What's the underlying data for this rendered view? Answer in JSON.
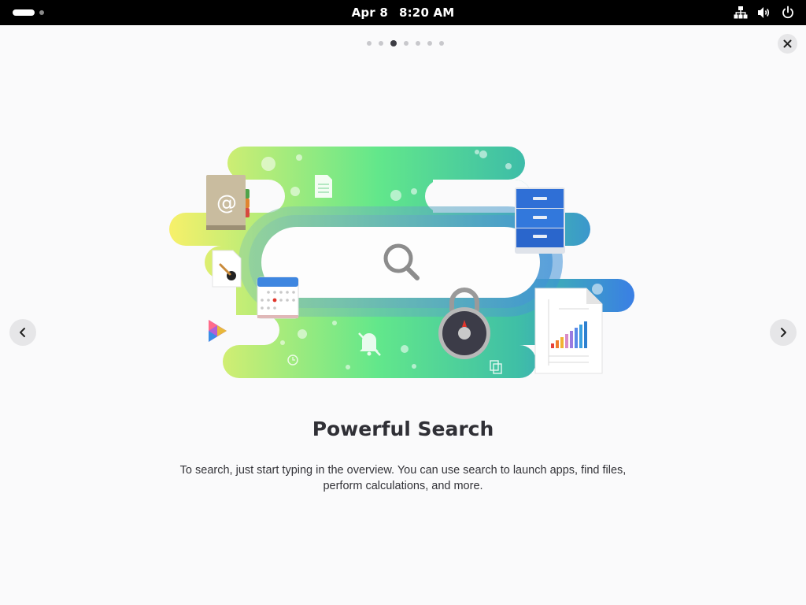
{
  "topbar": {
    "date": "Apr 8",
    "time": "8:20 AM",
    "icons": [
      "network-icon",
      "volume-icon",
      "power-icon"
    ]
  },
  "pager": {
    "total": 7,
    "current": 3
  },
  "slide": {
    "title": "Powerful Search",
    "description_line1": "To search, just start typing in the overview. You can use search to launch apps, find files,",
    "description_line2": "perform calculations, and more."
  },
  "illustration": {
    "icons": [
      "search-icon",
      "contacts-icon",
      "document-icon",
      "paint-icon",
      "calendar-icon",
      "files-icon",
      "lock-icon",
      "spreadsheet-icon",
      "notifications-off-icon",
      "clock-icon",
      "copy-icon",
      "video-icon"
    ]
  },
  "colors": {
    "topbar": "#000000",
    "background": "#fafafb",
    "wave_start": "#f5ef60",
    "wave_mid": "#5ee68a",
    "wave_end": "#3a84e0"
  }
}
